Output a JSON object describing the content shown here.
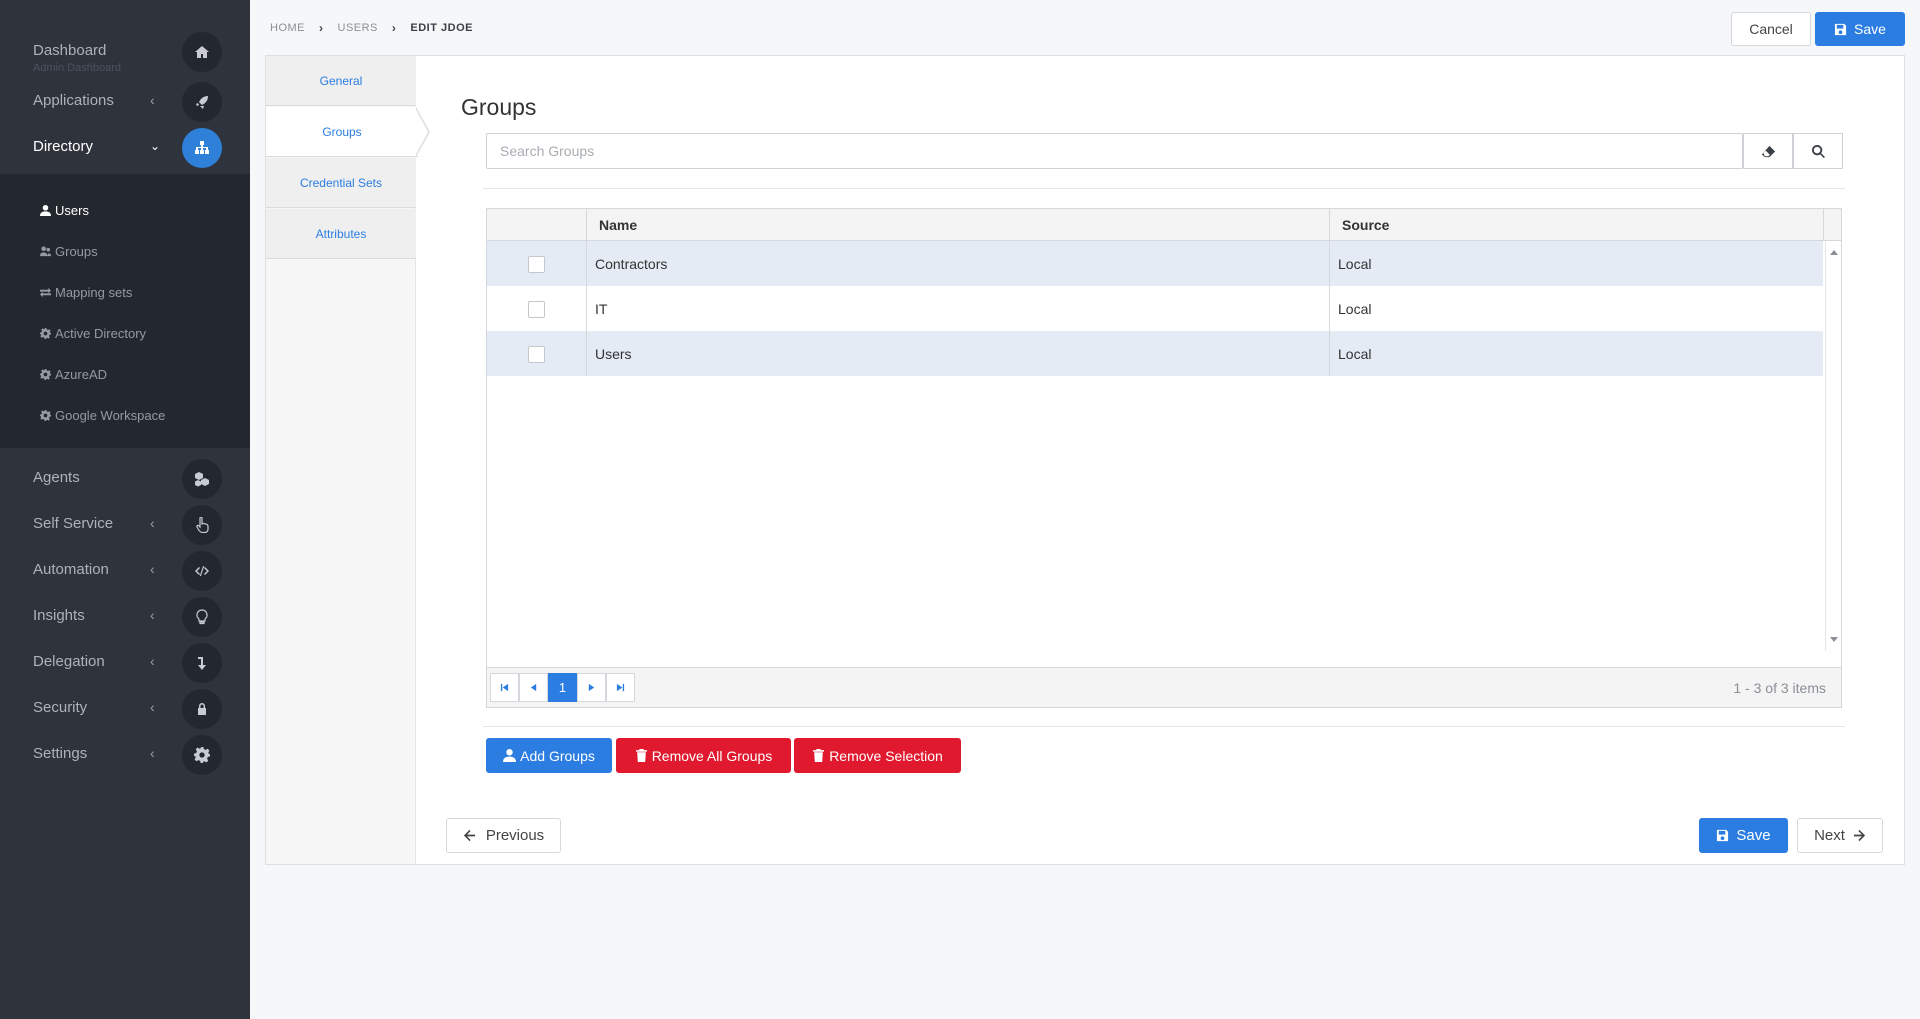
{
  "sidebar": {
    "items": [
      {
        "label": "Dashboard",
        "sub": "Admin Dashboard",
        "icon": "home-icon"
      },
      {
        "label": "Applications",
        "icon": "rocket-icon"
      },
      {
        "label": "Directory",
        "icon": "sitemap-icon"
      },
      {
        "label": "Agents",
        "icon": "cubes-icon"
      },
      {
        "label": "Self Service",
        "icon": "hand-pointer-icon"
      },
      {
        "label": "Automation",
        "icon": "code-icon"
      },
      {
        "label": "Insights",
        "icon": "lightbulb-icon"
      },
      {
        "label": "Delegation",
        "icon": "level-down-icon"
      },
      {
        "label": "Security",
        "icon": "lock-icon"
      },
      {
        "label": "Settings",
        "icon": "gear-icon"
      }
    ],
    "directory_sub": [
      {
        "label": "Users",
        "icon": "user-icon"
      },
      {
        "label": "Groups",
        "icon": "users-icon"
      },
      {
        "label": "Mapping sets",
        "icon": "exchange-icon"
      },
      {
        "label": "Active Directory",
        "icon": "cog-icon"
      },
      {
        "label": "AzureAD",
        "icon": "cog-icon"
      },
      {
        "label": "Google Workspace",
        "icon": "cog-icon"
      }
    ]
  },
  "breadcrumb": [
    "HOME",
    "USERS",
    "EDIT JDOE"
  ],
  "header": {
    "cancel_label": "Cancel",
    "save_label": "Save"
  },
  "tabs": [
    "General",
    "Groups",
    "Credential Sets",
    "Attributes"
  ],
  "section_title": "Groups",
  "search": {
    "placeholder": "Search Groups",
    "value": ""
  },
  "grid": {
    "columns": [
      "Name",
      "Source"
    ],
    "rows": [
      {
        "name": "Contractors",
        "source": "Local"
      },
      {
        "name": "IT",
        "source": "Local"
      },
      {
        "name": "Users",
        "source": "Local"
      }
    ],
    "current_page": "1",
    "info": "1 - 3 of 3 items"
  },
  "actions": {
    "add_groups": "Add Groups",
    "remove_all": "Remove All Groups",
    "remove_selection": "Remove Selection"
  },
  "footer": {
    "previous": "Previous",
    "save": "Save",
    "next": "Next"
  },
  "colors": {
    "primary": "#2b7de1",
    "danger": "#e0192f",
    "sidebar": "#2e333c",
    "row_alt": "#e4ebf4"
  }
}
